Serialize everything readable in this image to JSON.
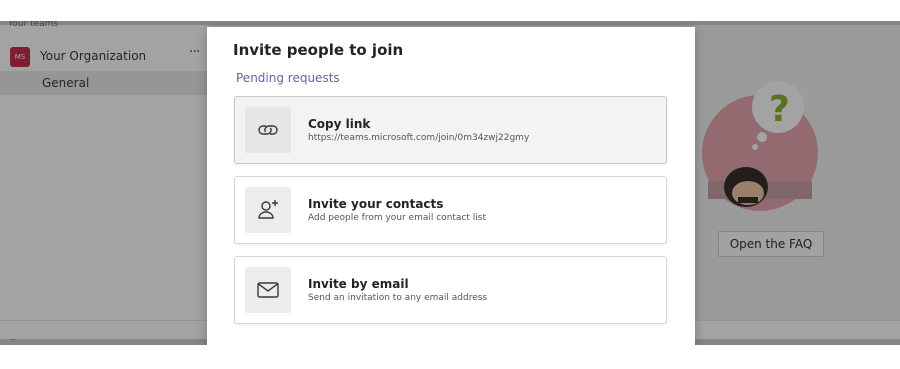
{
  "sidebar": {
    "teams_heading": "Your teams",
    "org_avatar_initials": "MS",
    "org_name": "Your Organization",
    "more_label": "···",
    "channel_name": "General",
    "bottom_text": "☺"
  },
  "background": {
    "faq_button_label": "Open the FAQ",
    "illustration_icon": "question-illustration"
  },
  "dialog": {
    "title": "Invite people to join",
    "pending_link": "Pending requests",
    "options": [
      {
        "title": "Copy link",
        "subtitle": "https://teams.microsoft.com/join/0m34zwj22gmy",
        "icon": "link-icon"
      },
      {
        "title": "Invite your contacts",
        "subtitle": "Add people from your email contact list",
        "icon": "add-person-icon"
      },
      {
        "title": "Invite by email",
        "subtitle": "Send an invitation to any email address",
        "icon": "mail-icon"
      }
    ]
  },
  "colors": {
    "accent": "#6264a7",
    "org_avatar": "#c4314b",
    "illustration_circle": "#e4a6ae",
    "question_mark": "#8bb43a"
  }
}
